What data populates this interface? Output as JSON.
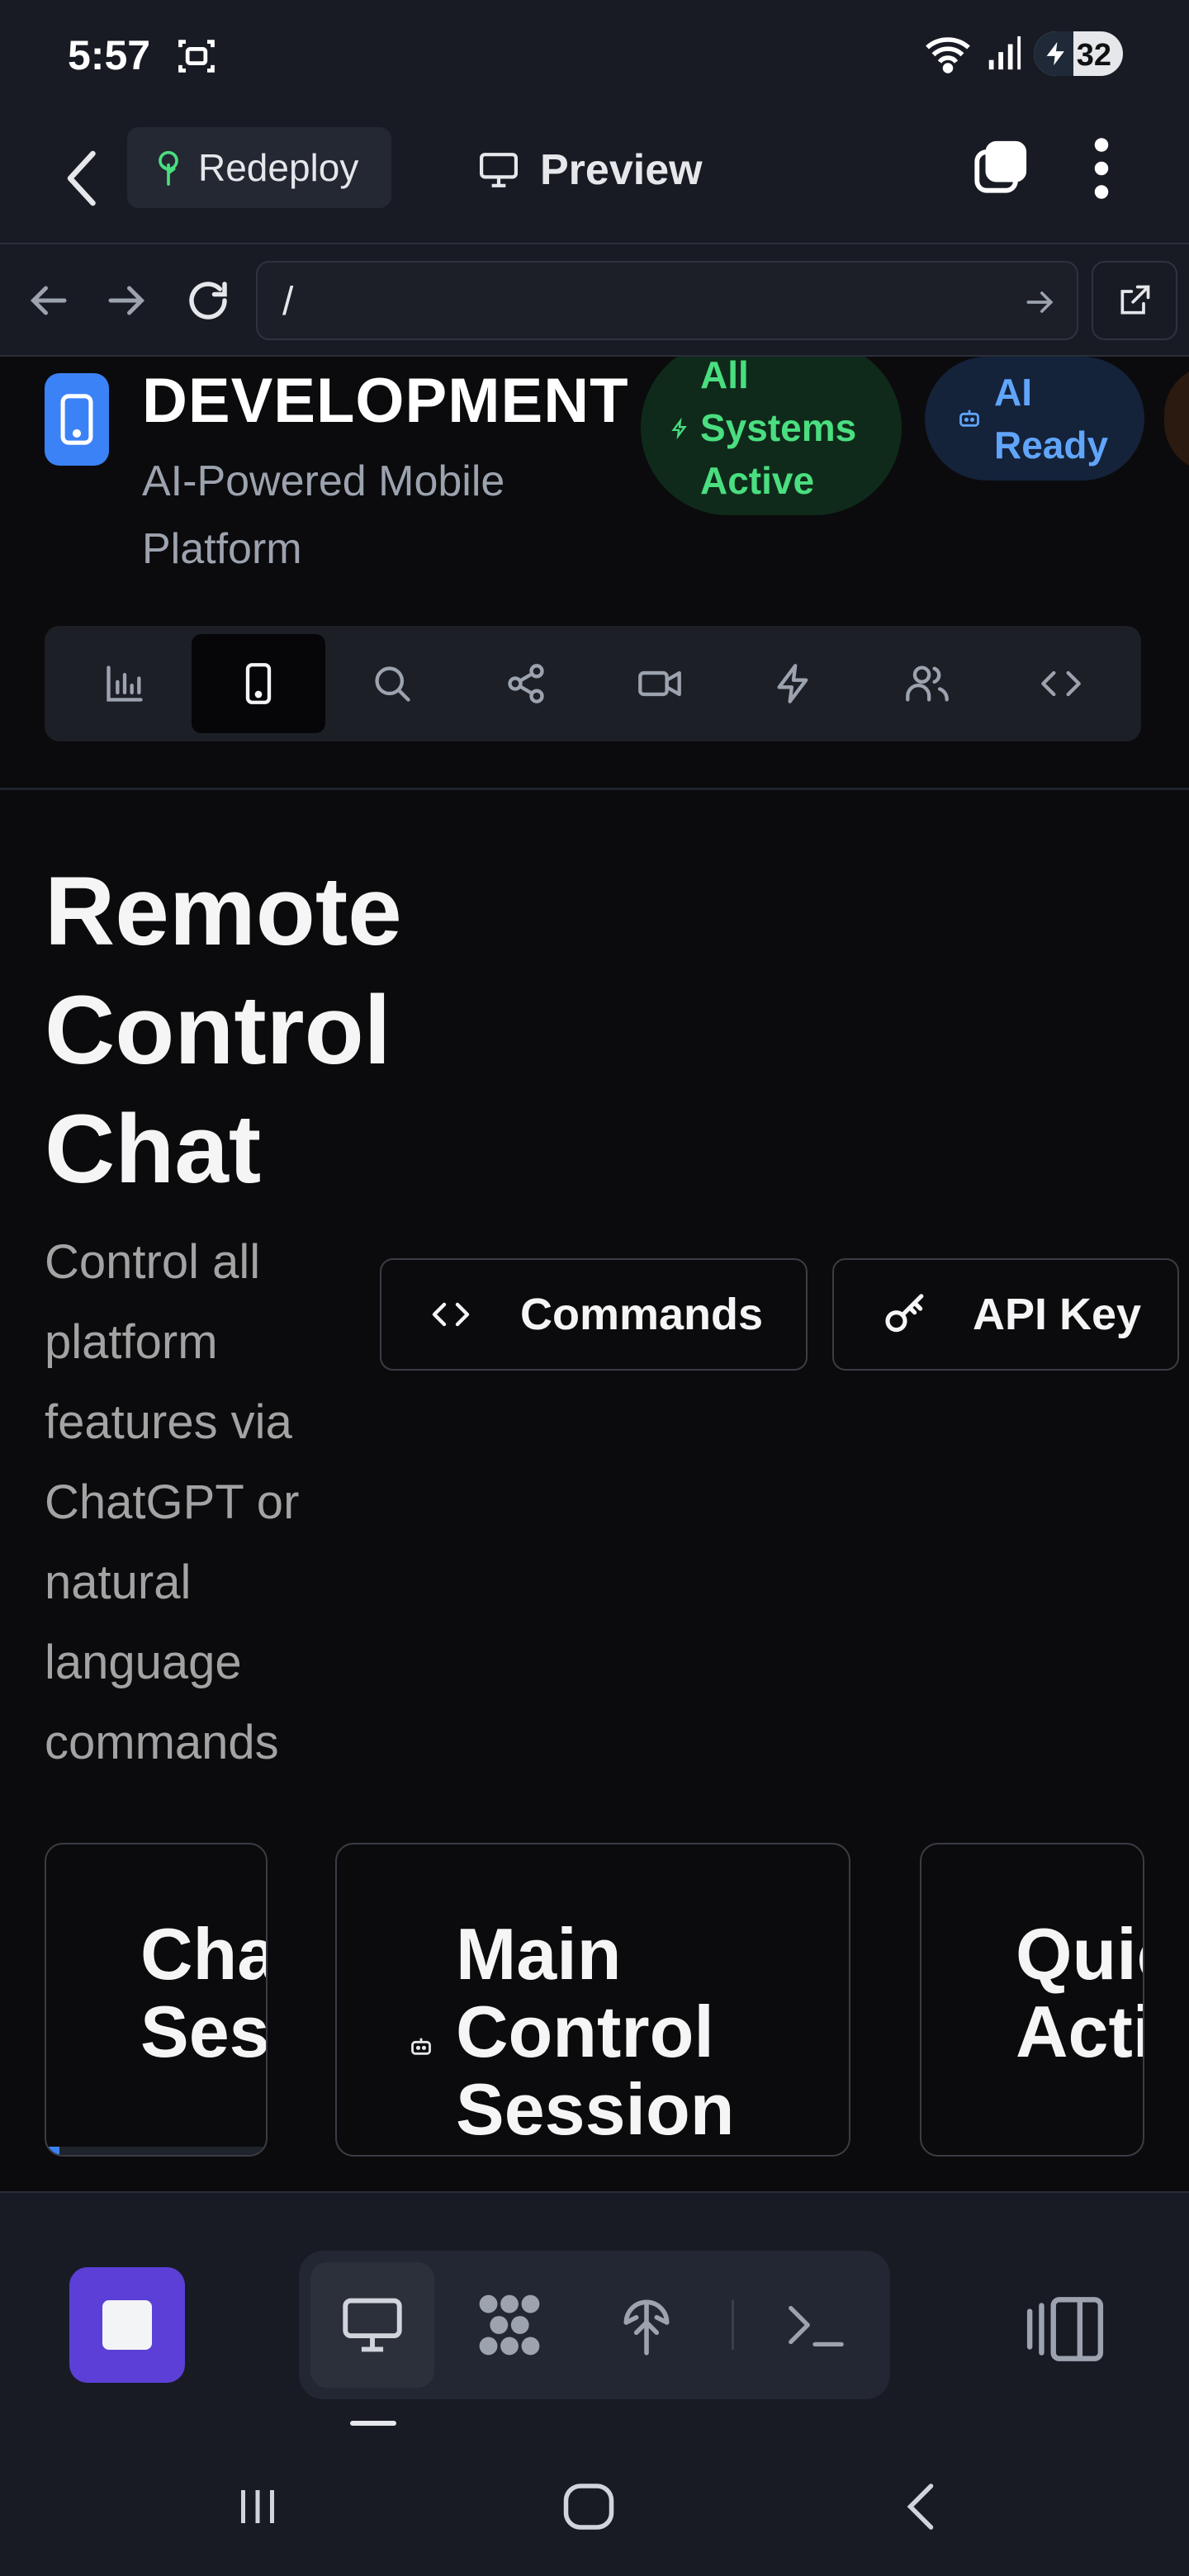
{
  "status_bar": {
    "time": "5:57",
    "battery": "32"
  },
  "app_bar": {
    "redeploy_label": "Redeploy",
    "preview_label": "Preview"
  },
  "browser": {
    "url": "/"
  },
  "header": {
    "brand_title": "DEVELOPMENT",
    "brand_subtitle": "AI-Powered Mobile Platform",
    "status_pills": [
      {
        "label": "All Systems Active",
        "color": "#4ade80"
      },
      {
        "label": "AI Ready",
        "color": "#60a5fa"
      }
    ]
  },
  "toolbar": {
    "items": [
      {
        "name": "analytics",
        "icon": "bar-chart-icon"
      },
      {
        "name": "mobile",
        "icon": "smartphone-icon",
        "active": true
      },
      {
        "name": "search",
        "icon": "search-icon"
      },
      {
        "name": "share",
        "icon": "share-icon"
      },
      {
        "name": "video",
        "icon": "video-icon"
      },
      {
        "name": "automation",
        "icon": "zap-icon"
      },
      {
        "name": "users",
        "icon": "users-icon"
      },
      {
        "name": "code",
        "icon": "code-icon"
      }
    ]
  },
  "main": {
    "title": "Remote Control Chat",
    "description": "Control all platform features via ChatGPT or natural language commands",
    "commands_label": "Commands",
    "api_key_label": "API Key"
  },
  "cards": [
    {
      "title": "Chat Sessions"
    },
    {
      "title": "Main Control Session"
    },
    {
      "title": "Quick Actions"
    }
  ],
  "colors": {
    "accent": "#5b3fd6",
    "brand_blue": "#3b82f6",
    "background": "#0b0b0d",
    "chrome": "#181b24"
  }
}
